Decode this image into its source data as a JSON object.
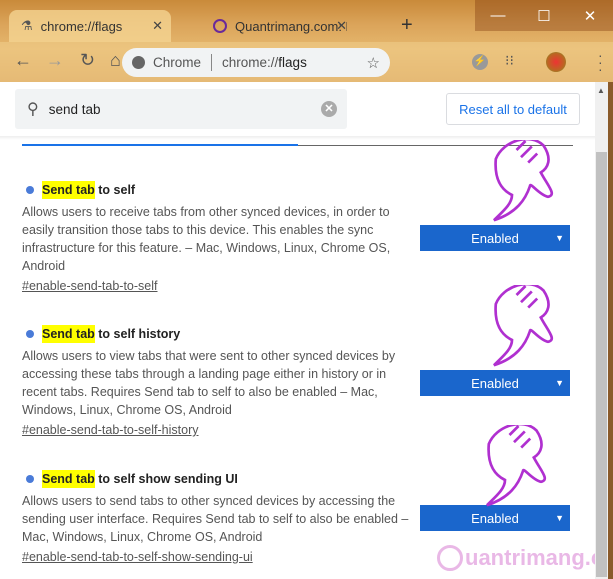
{
  "browser": {
    "tabs": [
      {
        "label": "chrome://flags",
        "icon": "flask-icon"
      },
      {
        "label": "Quantrimang.com: Kiế",
        "icon": "quantrimang-icon"
      }
    ],
    "omnibox": {
      "site": "Chrome",
      "url_prefix": "chrome://",
      "url_host": "flags"
    }
  },
  "search": {
    "value": "send tab"
  },
  "reset_label": "Reset all to default",
  "entries": [
    {
      "highlight": "Send tab",
      "title_rest": " to self",
      "desc": "Allows users to receive tabs from other synced devices, in order to easily transition those tabs to this device. This enables the sync infrastructure for this feature. – Mac, Windows, Linux, Chrome OS, Android",
      "link": "#enable-send-tab-to-self",
      "value": "Enabled"
    },
    {
      "highlight": "Send tab",
      "title_rest": " to self history",
      "desc": "Allows users to view tabs that were sent to other synced devices by accessing these tabs through a landing page either in history or in recent tabs. Requires Send tab to self to also be enabled – Mac, Windows, Linux, Chrome OS, Android",
      "link": "#enable-send-tab-to-self-history",
      "value": "Enabled"
    },
    {
      "highlight": "Send tab",
      "title_rest": " to self show sending UI",
      "desc": "Allows users to send tabs to other synced devices by accessing the sending user interface. Requires Send tab to self to also be enabled – Mac, Windows, Linux, Chrome OS, Android",
      "link": "#enable-send-tab-to-self-show-sending-ui",
      "value": "Enabled"
    }
  ],
  "watermark": "uantrimang.com",
  "colors": {
    "accent": "#1a73e8",
    "select": "#1a66cc",
    "highlight": "#ffff00",
    "hand": "#b030d0"
  }
}
